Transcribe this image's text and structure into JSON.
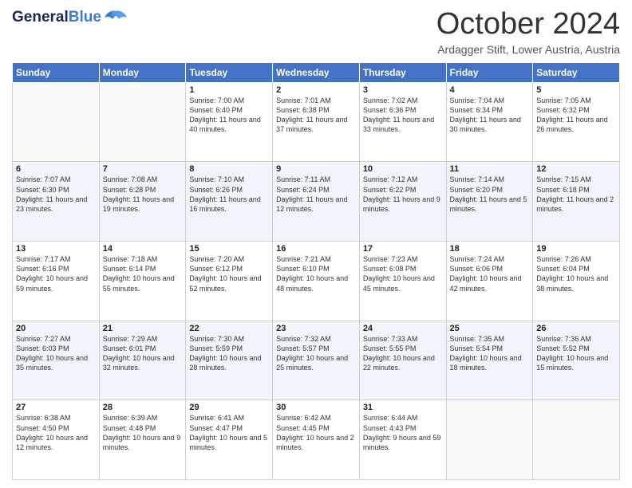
{
  "header": {
    "logo_general": "General",
    "logo_blue": "Blue",
    "month": "October 2024",
    "location": "Ardagger Stift, Lower Austria, Austria"
  },
  "weekdays": [
    "Sunday",
    "Monday",
    "Tuesday",
    "Wednesday",
    "Thursday",
    "Friday",
    "Saturday"
  ],
  "weeks": [
    [
      {
        "day": "",
        "info": ""
      },
      {
        "day": "",
        "info": ""
      },
      {
        "day": "1",
        "info": "Sunrise: 7:00 AM\nSunset: 6:40 PM\nDaylight: 11 hours and 40 minutes."
      },
      {
        "day": "2",
        "info": "Sunrise: 7:01 AM\nSunset: 6:38 PM\nDaylight: 11 hours and 37 minutes."
      },
      {
        "day": "3",
        "info": "Sunrise: 7:02 AM\nSunset: 6:36 PM\nDaylight: 11 hours and 33 minutes."
      },
      {
        "day": "4",
        "info": "Sunrise: 7:04 AM\nSunset: 6:34 PM\nDaylight: 11 hours and 30 minutes."
      },
      {
        "day": "5",
        "info": "Sunrise: 7:05 AM\nSunset: 6:32 PM\nDaylight: 11 hours and 26 minutes."
      }
    ],
    [
      {
        "day": "6",
        "info": "Sunrise: 7:07 AM\nSunset: 6:30 PM\nDaylight: 11 hours and 23 minutes."
      },
      {
        "day": "7",
        "info": "Sunrise: 7:08 AM\nSunset: 6:28 PM\nDaylight: 11 hours and 19 minutes."
      },
      {
        "day": "8",
        "info": "Sunrise: 7:10 AM\nSunset: 6:26 PM\nDaylight: 11 hours and 16 minutes."
      },
      {
        "day": "9",
        "info": "Sunrise: 7:11 AM\nSunset: 6:24 PM\nDaylight: 11 hours and 12 minutes."
      },
      {
        "day": "10",
        "info": "Sunrise: 7:12 AM\nSunset: 6:22 PM\nDaylight: 11 hours and 9 minutes."
      },
      {
        "day": "11",
        "info": "Sunrise: 7:14 AM\nSunset: 6:20 PM\nDaylight: 11 hours and 5 minutes."
      },
      {
        "day": "12",
        "info": "Sunrise: 7:15 AM\nSunset: 6:18 PM\nDaylight: 11 hours and 2 minutes."
      }
    ],
    [
      {
        "day": "13",
        "info": "Sunrise: 7:17 AM\nSunset: 6:16 PM\nDaylight: 10 hours and 59 minutes."
      },
      {
        "day": "14",
        "info": "Sunrise: 7:18 AM\nSunset: 6:14 PM\nDaylight: 10 hours and 55 minutes."
      },
      {
        "day": "15",
        "info": "Sunrise: 7:20 AM\nSunset: 6:12 PM\nDaylight: 10 hours and 52 minutes."
      },
      {
        "day": "16",
        "info": "Sunrise: 7:21 AM\nSunset: 6:10 PM\nDaylight: 10 hours and 48 minutes."
      },
      {
        "day": "17",
        "info": "Sunrise: 7:23 AM\nSunset: 6:08 PM\nDaylight: 10 hours and 45 minutes."
      },
      {
        "day": "18",
        "info": "Sunrise: 7:24 AM\nSunset: 6:06 PM\nDaylight: 10 hours and 42 minutes."
      },
      {
        "day": "19",
        "info": "Sunrise: 7:26 AM\nSunset: 6:04 PM\nDaylight: 10 hours and 38 minutes."
      }
    ],
    [
      {
        "day": "20",
        "info": "Sunrise: 7:27 AM\nSunset: 6:03 PM\nDaylight: 10 hours and 35 minutes."
      },
      {
        "day": "21",
        "info": "Sunrise: 7:29 AM\nSunset: 6:01 PM\nDaylight: 10 hours and 32 minutes."
      },
      {
        "day": "22",
        "info": "Sunrise: 7:30 AM\nSunset: 5:59 PM\nDaylight: 10 hours and 28 minutes."
      },
      {
        "day": "23",
        "info": "Sunrise: 7:32 AM\nSunset: 5:57 PM\nDaylight: 10 hours and 25 minutes."
      },
      {
        "day": "24",
        "info": "Sunrise: 7:33 AM\nSunset: 5:55 PM\nDaylight: 10 hours and 22 minutes."
      },
      {
        "day": "25",
        "info": "Sunrise: 7:35 AM\nSunset: 5:54 PM\nDaylight: 10 hours and 18 minutes."
      },
      {
        "day": "26",
        "info": "Sunrise: 7:36 AM\nSunset: 5:52 PM\nDaylight: 10 hours and 15 minutes."
      }
    ],
    [
      {
        "day": "27",
        "info": "Sunrise: 6:38 AM\nSunset: 4:50 PM\nDaylight: 10 hours and 12 minutes."
      },
      {
        "day": "28",
        "info": "Sunrise: 6:39 AM\nSunset: 4:48 PM\nDaylight: 10 hours and 9 minutes."
      },
      {
        "day": "29",
        "info": "Sunrise: 6:41 AM\nSunset: 4:47 PM\nDaylight: 10 hours and 5 minutes."
      },
      {
        "day": "30",
        "info": "Sunrise: 6:42 AM\nSunset: 4:45 PM\nDaylight: 10 hours and 2 minutes."
      },
      {
        "day": "31",
        "info": "Sunrise: 6:44 AM\nSunset: 4:43 PM\nDaylight: 9 hours and 59 minutes."
      },
      {
        "day": "",
        "info": ""
      },
      {
        "day": "",
        "info": ""
      }
    ]
  ]
}
